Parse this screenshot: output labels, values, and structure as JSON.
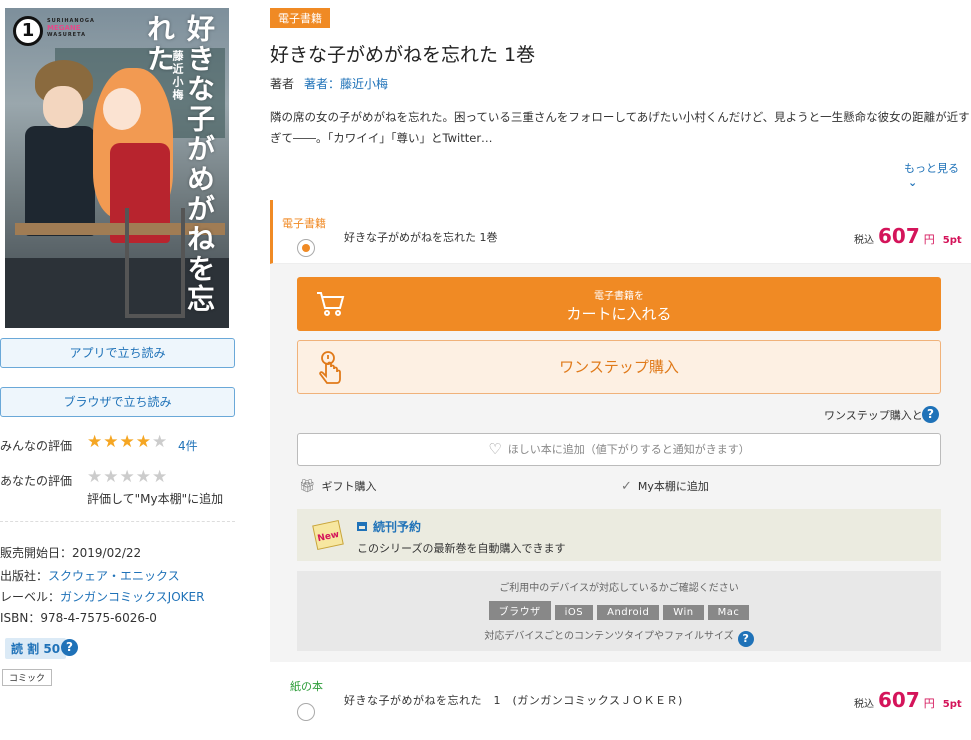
{
  "cover": {
    "volume": "1",
    "brand_line1": "SURIHANOGA",
    "brand_line2": "MEGANE",
    "brand_line3": "WASURETA",
    "title_vertical": "好きな子がめがねを忘れた",
    "author_vertical": "藤近小梅"
  },
  "left": {
    "read_app_label": "アプリで立ち読み",
    "read_browser_label": "ブラウザで立ち読み",
    "everyone_rating_label": "みんなの評価",
    "everyone_rating_stars": 4,
    "rating_count": "4件",
    "your_rating_label": "あなたの評価",
    "your_rating_stars": 0,
    "rate_hint": "評価して\"My本棚\"に追加",
    "release_date": "販売開始日：2019/02/22",
    "publisher_key": "出版社：",
    "publisher": "スクウェア・エニックス",
    "label_key": "レーベル：",
    "label": "ガンガンコミックスJOKER",
    "isbn": "ISBN：978-4-7575-6026-0",
    "read_badge": "読 割 50",
    "genre_tag": "コミック"
  },
  "product": {
    "format_label": "電子書籍",
    "title": "好きな子がめがねを忘れた 1巻",
    "author_key": "著者",
    "author_value": "著者：藤近小梅",
    "description": "隣の席の女の子がめがねを忘れた。困っている三重さんをフォローしてあげたい小村くんだけど、見ようと一生懸命な彼女の距離が近すぎて――。「カワイイ」「尊い」とTwitter…",
    "more_label": "もっと見る"
  },
  "purchase": {
    "ebook_option_label": "電子書籍",
    "ebook_option_name": "好きな子がめがねを忘れた 1巻",
    "tax_label": "税込",
    "ebook_price": "607",
    "yen": "円",
    "ebook_points": "5pt",
    "cart_small": "電子書籍を",
    "cart_large": "カートに入れる",
    "one_step": "ワンステップ購入",
    "one_step_what": "ワンステップ購入とは",
    "wishlist": "ほしい本に追加（値下がりすると通知がきます）",
    "gift": "ギフト購入",
    "my_shelf": "My本棚に追加",
    "series_title": "続刊予約",
    "series_sub": "このシリーズの最新巻を自動購入できます",
    "device_top": "ご利用中のデバイスが対応しているかご確認ください",
    "devices": [
      "ブラウザ",
      "iOS",
      "Android",
      "Win",
      "Mac"
    ],
    "device_bottom": "対応デバイスごとのコンテンツタイプやファイルサイズ",
    "paper_option_label": "紙の本",
    "paper_option_name": "好きな子がめがねを忘れた　1　(ガンガンコミックスＪＯＫＥＲ)",
    "paper_price": "607",
    "paper_points": "5pt"
  },
  "colors": {
    "accent_orange": "#f08a24",
    "link_blue": "#1f72b8",
    "price_red": "#d4145a",
    "paper_green": "#2e9d3a"
  }
}
